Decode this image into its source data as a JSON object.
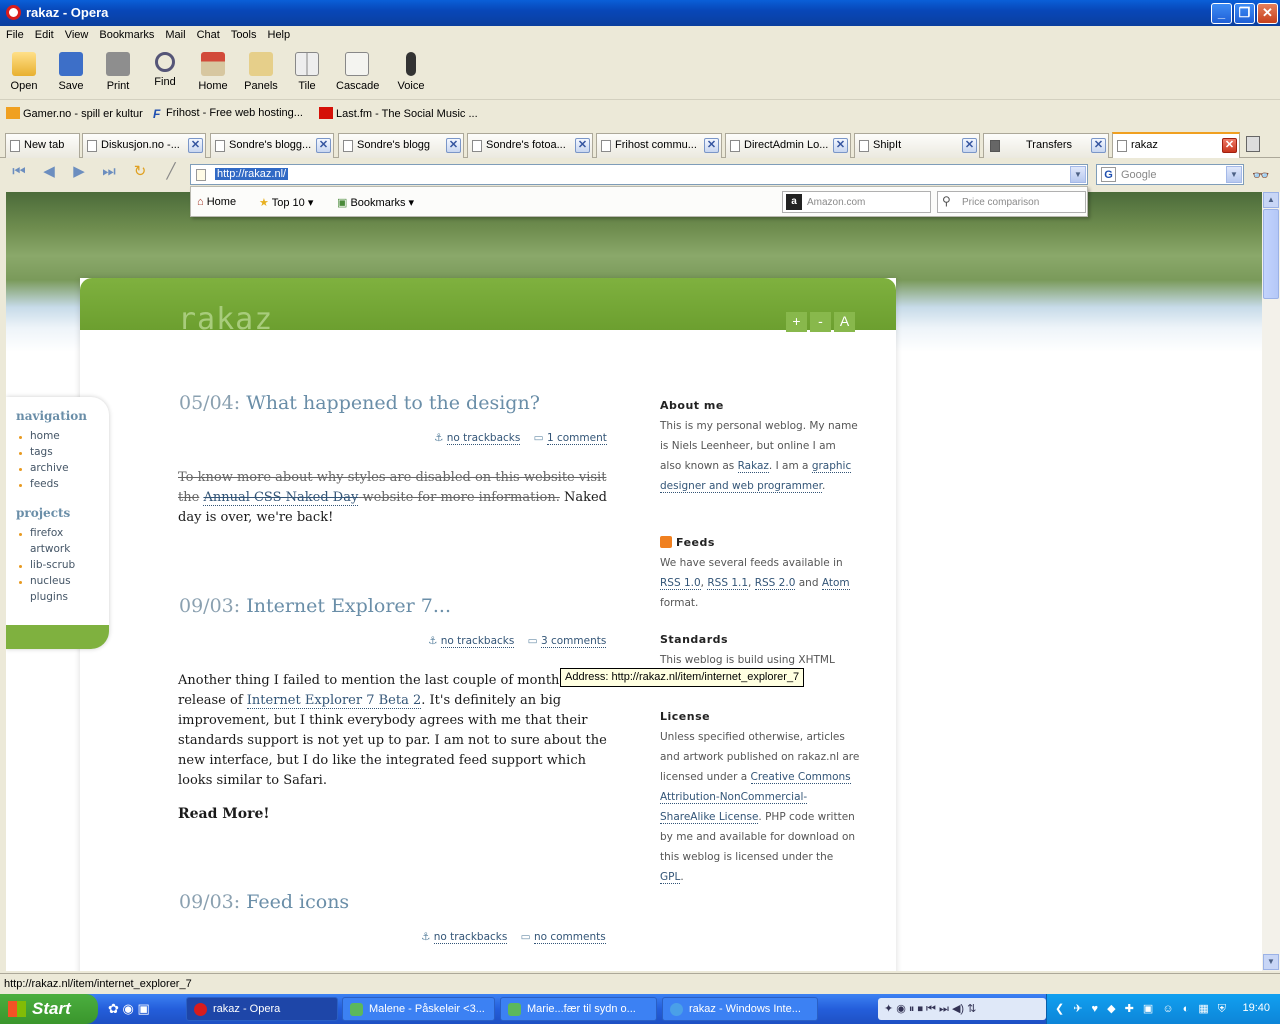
{
  "window": {
    "title": "rakaz - Opera"
  },
  "menu": [
    "File",
    "Edit",
    "View",
    "Bookmarks",
    "Mail",
    "Chat",
    "Tools",
    "Help"
  ],
  "toolbar": [
    {
      "label": "Open",
      "icon": "folder-icon"
    },
    {
      "label": "Save",
      "icon": "floppy-icon"
    },
    {
      "label": "Print",
      "icon": "printer-icon"
    },
    {
      "label": "Find",
      "icon": "magnifier-icon"
    },
    {
      "label": "Home",
      "icon": "house-icon"
    },
    {
      "label": "Panels",
      "icon": "panels-icon"
    },
    {
      "label": "Tile",
      "icon": "tile-icon"
    },
    {
      "label": "Cascade",
      "icon": "cascade-icon"
    },
    {
      "label": "Voice",
      "icon": "microphone-icon"
    }
  ],
  "bookmarks": [
    {
      "label": "Gamer.no - spill er kultur"
    },
    {
      "label": "Frihost - Free web hosting..."
    },
    {
      "label": "Last.fm - The Social Music ..."
    }
  ],
  "tabs": [
    {
      "label": "New tab"
    },
    {
      "label": "Diskusjon.no -..."
    },
    {
      "label": "Sondre's blogg..."
    },
    {
      "label": "Sondre's blogg"
    },
    {
      "label": "Sondre's fotoa..."
    },
    {
      "label": "Frihost commu..."
    },
    {
      "label": "DirectAdmin Lo..."
    },
    {
      "label": "ShipIt"
    },
    {
      "label": "Transfers"
    },
    {
      "label": "rakaz"
    }
  ],
  "address": {
    "url": "http://rakaz.nl/"
  },
  "search": {
    "placeholder": "Google"
  },
  "subbar": {
    "home": "Home",
    "top10": "Top 10",
    "bookmarks": "Bookmarks",
    "amazon": "Amazon.com",
    "price": "Price comparison"
  },
  "site": {
    "title": "rakaz",
    "size_buttons": [
      "+",
      "-",
      "A"
    ],
    "nav_heading": "navigation",
    "nav": [
      "home",
      "tags",
      "archive",
      "feeds"
    ],
    "projects_heading": "projects",
    "projects": [
      "firefox",
      "artwork",
      "lib-scrub",
      "nucleus",
      "plugins"
    ],
    "posts": [
      {
        "date": "05/04:",
        "title": "What happened to the design?",
        "trackbacks": "no trackbacks",
        "comments": "1 comment",
        "strike1": "To know more about why styles are disabled on this website visit the",
        "link": "Annual CSS Naked Day",
        "strike2": " website for more information.",
        "text": " Naked day is over, we're back!"
      },
      {
        "date": "09/03:",
        "title": "Internet Explorer 7...",
        "trackbacks": "no trackbacks",
        "comments": "3 comments",
        "text1": "Another thing I failed to mention the last couple of months. Th",
        "text1b": "release of ",
        "link": "Internet Explorer 7 Beta 2",
        "text2": ". It's definitely an big improvement, but I think everybody agrees with me that their standards support is not yet up to par. I am not to sure about the new interface, but I do like the integrated feed support which looks similar to Safari.",
        "more": "Read More!"
      },
      {
        "date": "09/03:",
        "title": "Feed icons",
        "trackbacks": "no trackbacks",
        "comments": "no comments"
      }
    ],
    "sidebar": {
      "about_h": "About me",
      "about_1": "This is my personal weblog. My name is Niels Leenheer, but online I am also known as ",
      "about_link": "Rakaz",
      "about_2": ". I am a ",
      "about_link2": "graphic designer and web programmer",
      "about_3": ".",
      "feeds_h": "Feeds",
      "feeds_1": "We have several feeds available in ",
      "rss10": "RSS 1.0",
      "rss11": "RSS 1.1",
      "rss20": "RSS 2.0",
      "atom": "Atom",
      "feeds_and": " and ",
      "feeds_2": " format.",
      "std_h": "Standards",
      "std_1": "This weblog is build using XHTML",
      "lic_h": "License",
      "lic_1": "Unless specified otherwise, articles and artwork published on rakaz.nl are licensed under a ",
      "lic_link": "Creative Commons Attribution-NonCommercial-ShareAlike License",
      "lic_2": ". PHP code written by me and available for download on this weblog is licensed under the ",
      "gpl": "GPL",
      "lic_3": "."
    }
  },
  "tooltip": "Address: http://rakaz.nl/item/internet_explorer_7",
  "status": "http://rakaz.nl/item/internet_explorer_7",
  "taskbar": {
    "start": "Start",
    "tasks": [
      "rakaz - Opera",
      "Malene - Påskeleir <3...",
      "Marie...fær til sydn o...",
      "rakaz - Windows Inte..."
    ],
    "clock": "19:40"
  }
}
